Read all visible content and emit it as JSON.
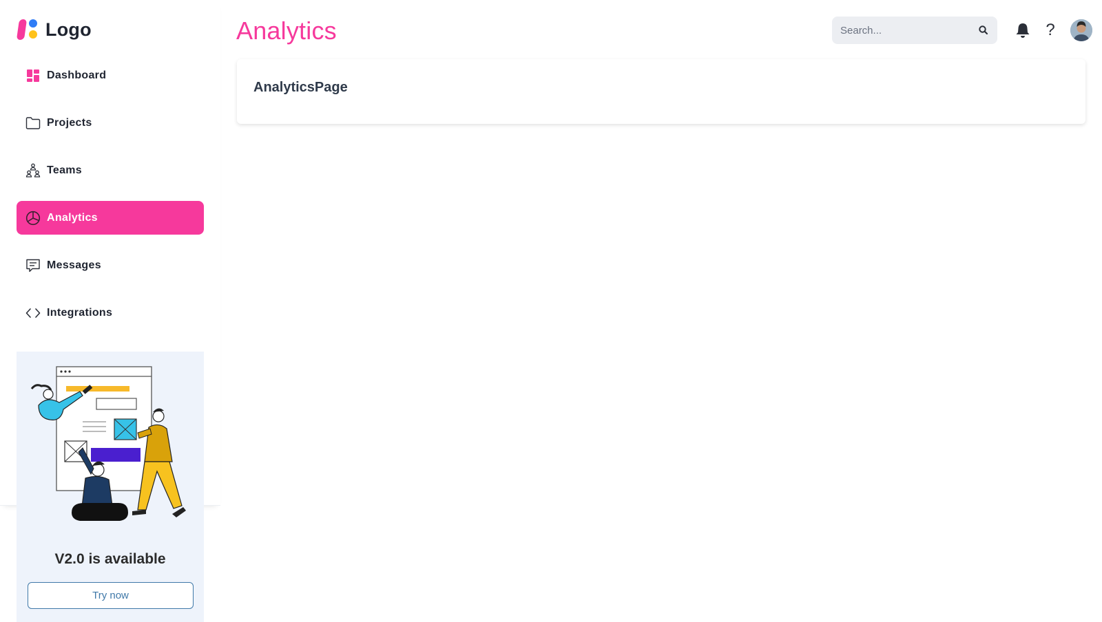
{
  "brand": {
    "logo_text": "Logo"
  },
  "header": {
    "title": "Analytics",
    "search": {
      "placeholder": "Search...",
      "value": ""
    },
    "icons": [
      "bell-icon",
      "help-icon",
      "avatar"
    ],
    "help_glyph": "?"
  },
  "sidebar": {
    "items": [
      {
        "label": "Dashboard",
        "icon": "dashboard-icon",
        "active": false
      },
      {
        "label": "Projects",
        "icon": "folder-icon",
        "active": false
      },
      {
        "label": "Teams",
        "icon": "teams-icon",
        "active": false
      },
      {
        "label": "Analytics",
        "icon": "pie-chart-icon",
        "active": true
      },
      {
        "label": "Messages",
        "icon": "message-icon",
        "active": false
      },
      {
        "label": "Integrations",
        "icon": "code-icon",
        "active": false
      }
    ],
    "promo": {
      "title": "V2.0 is available",
      "button_label": "Try now"
    }
  },
  "main": {
    "card_title": "AnalyticsPage"
  },
  "colors": {
    "accent": "#f6399c",
    "promo_bg": "#eef3fb",
    "promo_button": "#3f78a8",
    "search_bg": "#eceef2"
  }
}
